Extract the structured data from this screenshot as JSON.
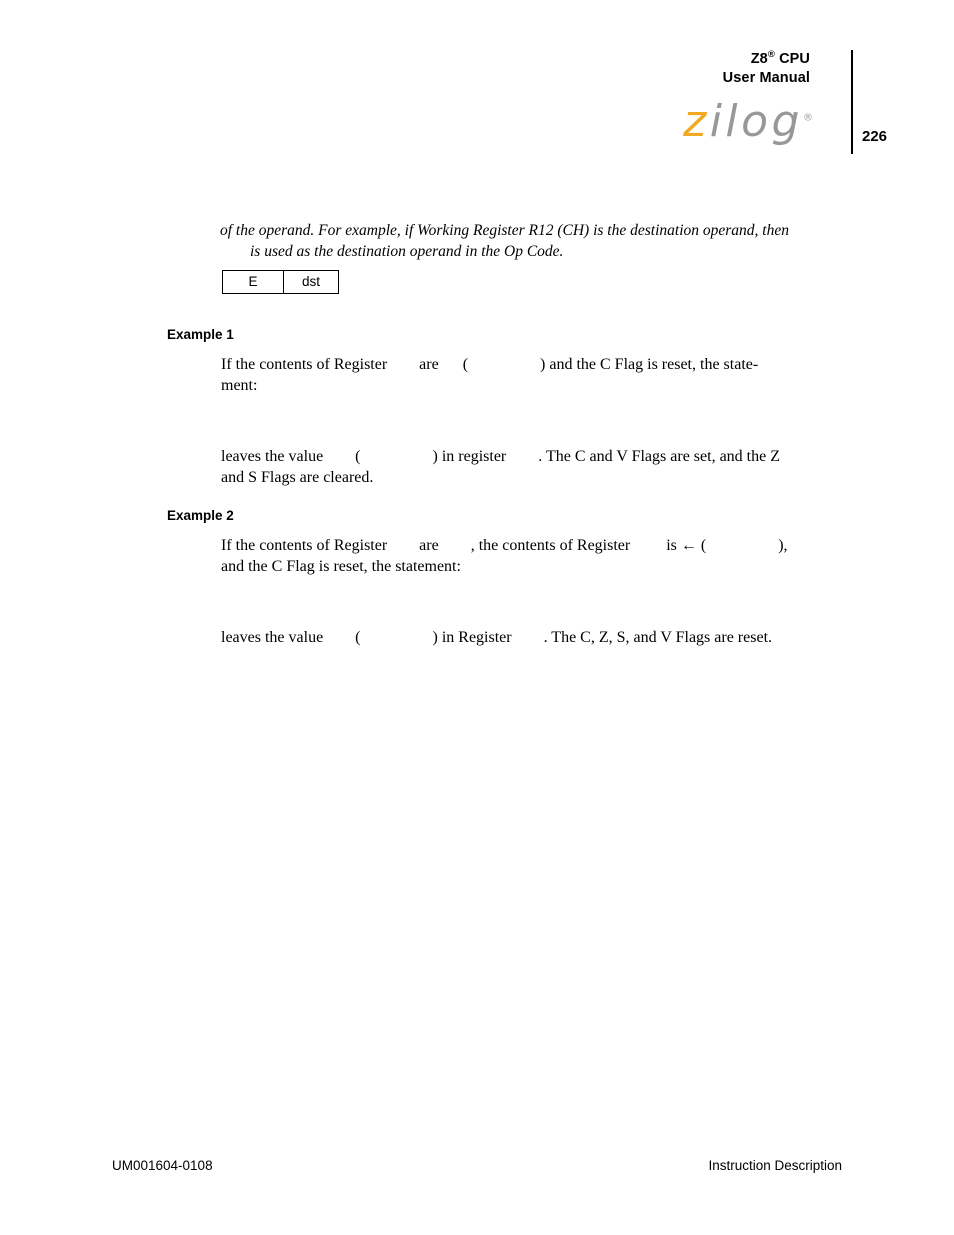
{
  "header": {
    "product_line_1_main": "Z8",
    "product_line_1_sup": "®",
    "product_line_1_tail": " CPU",
    "product_line_2": "User Manual",
    "page_number": "226",
    "logo": {
      "letter_z": "z",
      "letters_rest": "ilog",
      "registered_mark": "®"
    }
  },
  "content": {
    "intro_paragraph_line_1": "of the operand. For example, if Working Register R12 (CH) is the destination operand, then",
    "intro_paragraph_line_2": "is used as the destination operand in the Op Code.",
    "opcode_table": {
      "cells": [
        {
          "label": "E"
        },
        {
          "label": "dst"
        }
      ]
    },
    "example_1": {
      "heading": "Example 1",
      "paragraph_a": "If the contents of Register        are      (                  ) and the C Flag is reset, the state-\nment:",
      "paragraph_b": "leaves the value        (                  ) in register        . The C and V Flags are set, and the Z\nand S Flags are cleared."
    },
    "example_2": {
      "heading": "Example 2",
      "paragraph_a": "If the contents of Register        are        , the contents of Register         is ← (                  ),\nand the C Flag is reset, the statement:",
      "paragraph_b": "leaves the value        (                  ) in Register        . The C, Z, S, and V Flags are reset."
    }
  },
  "footer": {
    "document_id": "UM001604-0108",
    "section_name": "Instruction Description"
  },
  "colors": {
    "logo_accent": "#F2A922",
    "logo_gray": "#97989A",
    "text": "#000000",
    "background": "#FFFFFF"
  }
}
